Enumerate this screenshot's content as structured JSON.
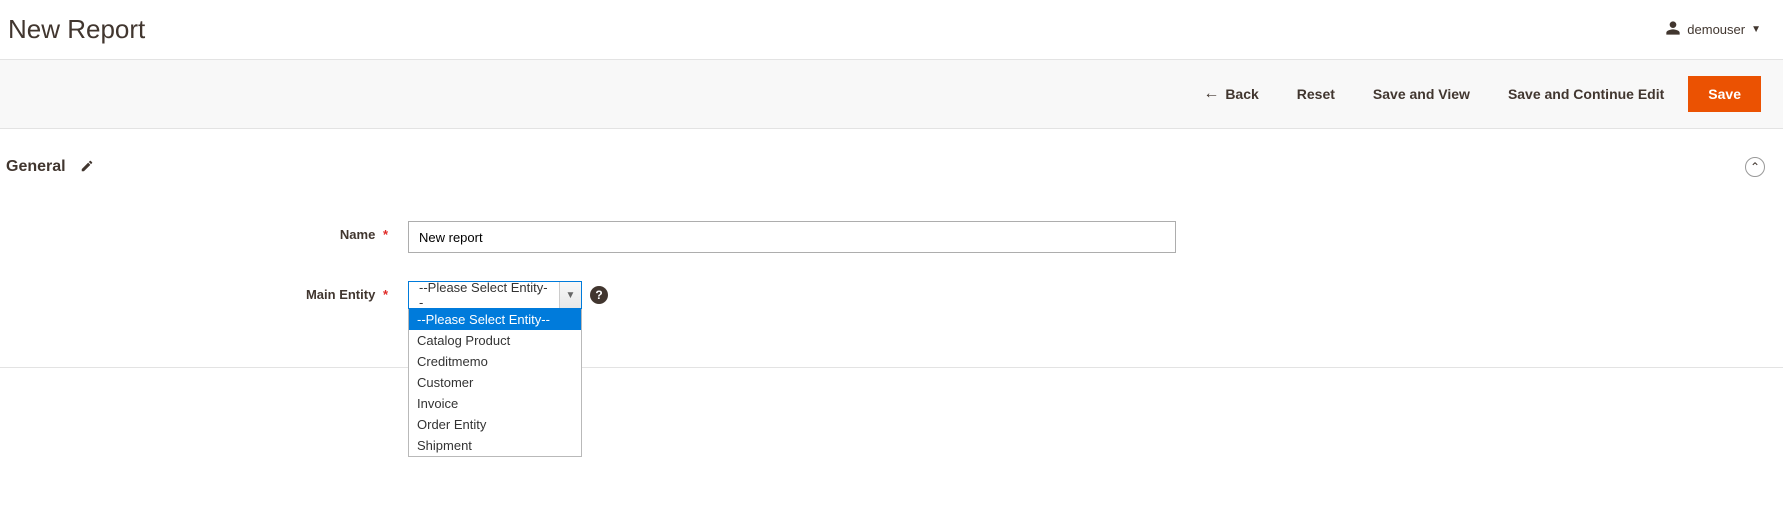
{
  "header": {
    "page_title": "New Report",
    "username": "demouser"
  },
  "actions": {
    "back": "Back",
    "reset": "Reset",
    "save_and_view": "Save and View",
    "save_and_continue": "Save and Continue Edit",
    "save": "Save"
  },
  "section": {
    "title": "General"
  },
  "form": {
    "name": {
      "label": "Name",
      "value": "New report"
    },
    "main_entity": {
      "label": "Main Entity",
      "selected_text": "--Please Select Entity--",
      "options": {
        "0": "--Please Select Entity--",
        "1": "Catalog Product",
        "2": "Creditmemo",
        "3": "Customer",
        "4": "Invoice",
        "5": "Order Entity",
        "6": "Shipment"
      }
    }
  }
}
